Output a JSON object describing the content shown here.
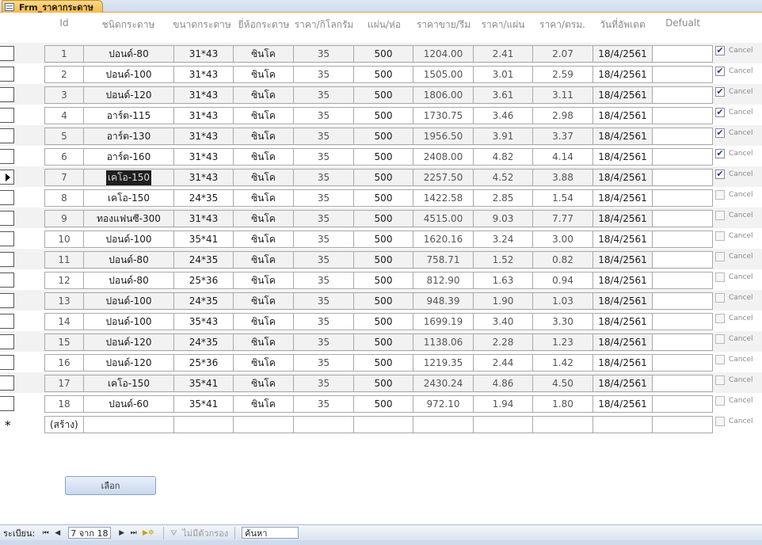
{
  "tab": {
    "title": "Frm_ราคากระดาษ"
  },
  "columns": {
    "id": "Id",
    "type": "ชนิดกระดาษ",
    "size": "ขนาดกระดาษ",
    "brand": "ยี่ห้อกระดาษ",
    "price_kg": "ราคา/กิโลกรัม",
    "sheets": "แผ่น/ห่อ",
    "price_ream": "ราคาขาย/รีม",
    "price_sheet": "ราคา/แผ่น",
    "price_sqin": "ราคา/ตรม.",
    "updated": "วันที่อัพเดต",
    "default": "Defualt"
  },
  "checkbox_label": "Cancel",
  "current_row_index": 6,
  "rows": [
    {
      "id": "1",
      "type": "ปอนด์-80",
      "size": "31*43",
      "brand": "ซินโค",
      "price_kg": "35",
      "sheets": "500",
      "price_ream": "1204.00",
      "price_sheet": "2.41",
      "price_sqin": "2.07",
      "updated": "18/4/2561",
      "cancel": true
    },
    {
      "id": "2",
      "type": "ปอนด์-100",
      "size": "31*43",
      "brand": "ซินโค",
      "price_kg": "35",
      "sheets": "500",
      "price_ream": "1505.00",
      "price_sheet": "3.01",
      "price_sqin": "2.59",
      "updated": "18/4/2561",
      "cancel": true
    },
    {
      "id": "3",
      "type": "ปอนด์-120",
      "size": "31*43",
      "brand": "ซินโค",
      "price_kg": "35",
      "sheets": "500",
      "price_ream": "1806.00",
      "price_sheet": "3.61",
      "price_sqin": "3.11",
      "updated": "18/4/2561",
      "cancel": true
    },
    {
      "id": "4",
      "type": "อาร์ต-115",
      "size": "31*43",
      "brand": "ซินโค",
      "price_kg": "35",
      "sheets": "500",
      "price_ream": "1730.75",
      "price_sheet": "3.46",
      "price_sqin": "2.98",
      "updated": "18/4/2561",
      "cancel": true
    },
    {
      "id": "5",
      "type": "อาร์ต-130",
      "size": "31*43",
      "brand": "ซินโค",
      "price_kg": "35",
      "sheets": "500",
      "price_ream": "1956.50",
      "price_sheet": "3.91",
      "price_sqin": "3.37",
      "updated": "18/4/2561",
      "cancel": true
    },
    {
      "id": "6",
      "type": "อาร์ต-160",
      "size": "31*43",
      "brand": "ซินโค",
      "price_kg": "35",
      "sheets": "500",
      "price_ream": "2408.00",
      "price_sheet": "4.82",
      "price_sqin": "4.14",
      "updated": "18/4/2561",
      "cancel": true
    },
    {
      "id": "7",
      "type": "เคโอ-150",
      "size": "31*43",
      "brand": "ซินโค",
      "price_kg": "35",
      "sheets": "500",
      "price_ream": "2257.50",
      "price_sheet": "4.52",
      "price_sqin": "3.88",
      "updated": "18/4/2561",
      "cancel": true
    },
    {
      "id": "8",
      "type": "เคโอ-150",
      "size": "24*35",
      "brand": "ซินโค",
      "price_kg": "35",
      "sheets": "500",
      "price_ream": "1422.58",
      "price_sheet": "2.85",
      "price_sqin": "1.54",
      "updated": "18/4/2561",
      "cancel": false
    },
    {
      "id": "9",
      "type": "ทองแฟนซี-300",
      "size": "31*43",
      "brand": "ซินโค",
      "price_kg": "35",
      "sheets": "500",
      "price_ream": "4515.00",
      "price_sheet": "9.03",
      "price_sqin": "7.77",
      "updated": "18/4/2561",
      "cancel": false
    },
    {
      "id": "10",
      "type": "ปอนด์-100",
      "size": "35*41",
      "brand": "ซินโค",
      "price_kg": "35",
      "sheets": "500",
      "price_ream": "1620.16",
      "price_sheet": "3.24",
      "price_sqin": "3.00",
      "updated": "18/4/2561",
      "cancel": false
    },
    {
      "id": "11",
      "type": "ปอนด์-80",
      "size": "24*35",
      "brand": "ซินโค",
      "price_kg": "35",
      "sheets": "500",
      "price_ream": "758.71",
      "price_sheet": "1.52",
      "price_sqin": "0.82",
      "updated": "18/4/2561",
      "cancel": false
    },
    {
      "id": "12",
      "type": "ปอนด์-80",
      "size": "25*36",
      "brand": "ซินโค",
      "price_kg": "35",
      "sheets": "500",
      "price_ream": "812.90",
      "price_sheet": "1.63",
      "price_sqin": "0.94",
      "updated": "18/4/2561",
      "cancel": false
    },
    {
      "id": "13",
      "type": "ปอนด์-100",
      "size": "24*35",
      "brand": "ซินโค",
      "price_kg": "35",
      "sheets": "500",
      "price_ream": "948.39",
      "price_sheet": "1.90",
      "price_sqin": "1.03",
      "updated": "18/4/2561",
      "cancel": false
    },
    {
      "id": "14",
      "type": "ปอนด์-100",
      "size": "35*43",
      "brand": "ซินโค",
      "price_kg": "35",
      "sheets": "500",
      "price_ream": "1699.19",
      "price_sheet": "3.40",
      "price_sqin": "3.30",
      "updated": "18/4/2561",
      "cancel": false
    },
    {
      "id": "15",
      "type": "ปอนด์-120",
      "size": "24*35",
      "brand": "ซินโค",
      "price_kg": "35",
      "sheets": "500",
      "price_ream": "1138.06",
      "price_sheet": "2.28",
      "price_sqin": "1.23",
      "updated": "18/4/2561",
      "cancel": false
    },
    {
      "id": "16",
      "type": "ปอนด์-120",
      "size": "25*36",
      "brand": "ซินโค",
      "price_kg": "35",
      "sheets": "500",
      "price_ream": "1219.35",
      "price_sheet": "2.44",
      "price_sqin": "1.42",
      "updated": "18/4/2561",
      "cancel": false
    },
    {
      "id": "17",
      "type": "เคโอ-150",
      "size": "35*41",
      "brand": "ซินโค",
      "price_kg": "35",
      "sheets": "500",
      "price_ream": "2430.24",
      "price_sheet": "4.86",
      "price_sqin": "4.50",
      "updated": "18/4/2561",
      "cancel": false
    },
    {
      "id": "18",
      "type": "ปอนด์-60",
      "size": "35*41",
      "brand": "ซินโค",
      "price_kg": "35",
      "sheets": "500",
      "price_ream": "972.10",
      "price_sheet": "1.94",
      "price_sqin": "1.80",
      "updated": "18/4/2561",
      "cancel": false
    }
  ],
  "new_record_label": "(สร้าง)",
  "select_button": "เลือก",
  "navigation": {
    "record_label": "ระเบียน:",
    "first": "⏮",
    "prev": "◀",
    "current": "7 จาก 18",
    "next": "▶",
    "last": "⏭",
    "new": "▶✲",
    "filter_label": "ไม่มีตัวกรอง",
    "search_placeholder": "ค้นหา"
  },
  "colors": {
    "tab_accent": "#f6b945",
    "checkbox_tick": "#1d3c8c"
  }
}
